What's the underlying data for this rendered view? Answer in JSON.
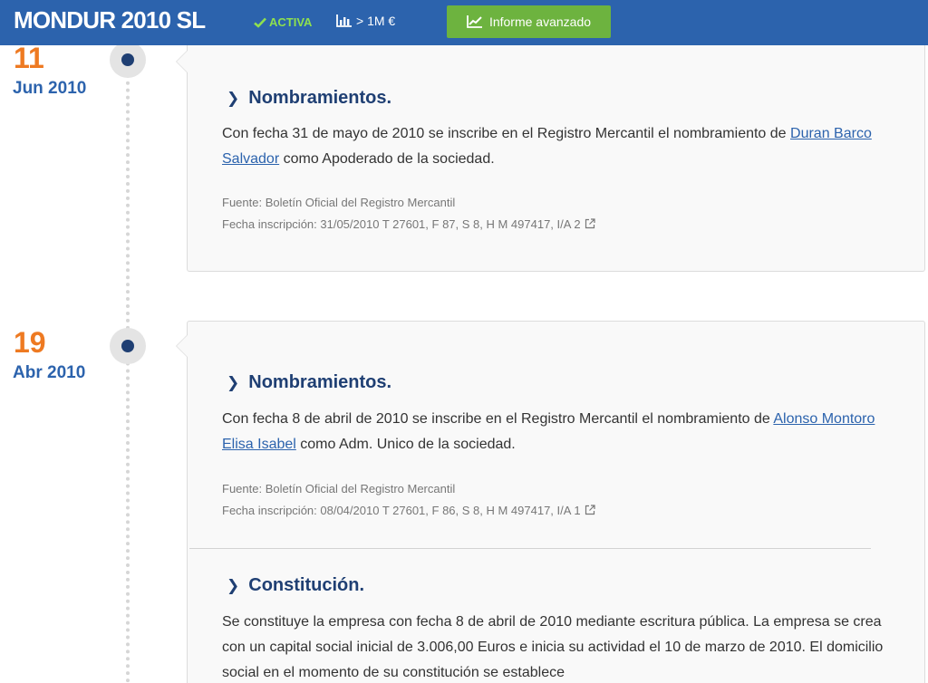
{
  "header": {
    "company": "MONDUR 2010 SL",
    "status": "ACTIVA",
    "revenue": "> 1M €",
    "report_button": "Informe avanzado"
  },
  "timeline": [
    {
      "day": "11",
      "month": "Jun 2010",
      "entries": [
        {
          "title": "Nombramientos.",
          "text_before": "Con fecha 31 de mayo de 2010 se inscribe en el Registro Mercantil el nombramiento de ",
          "link": "Duran Barco Salvador",
          "text_after": " como Apoderado de la sociedad.",
          "source": "Fuente: Boletín Oficial del Registro Mercantil",
          "inscription": "Fecha inscripción: 31/05/2010 T 27601, F 87, S 8, H M 497417, I/A 2"
        }
      ]
    },
    {
      "day": "19",
      "month": "Abr 2010",
      "entries": [
        {
          "title": "Nombramientos.",
          "text_before": "Con fecha 8 de abril de 2010 se inscribe en el Registro Mercantil el nombramiento de ",
          "link": "Alonso Montoro Elisa Isabel",
          "text_after": " como Adm. Unico de la sociedad.",
          "source": "Fuente: Boletín Oficial del Registro Mercantil",
          "inscription": "Fecha inscripción: 08/04/2010 T 27601, F 86, S 8, H M 497417, I/A 1"
        },
        {
          "title": "Constitución.",
          "text": "Se constituye la empresa con fecha 8 de abril de 2010 mediante escritura pública. La empresa se crea con un capital social inicial de 3.006,00 Euros e inicia su actividad el 10 de marzo de 2010. El domicilio social en el momento de su constitución se establece"
        }
      ]
    }
  ],
  "icons": {
    "status": "check-icon",
    "revenue": "bar-chart-icon",
    "report": "trend-line-icon",
    "inscription": "external-link-icon",
    "title": "chevron-right-icon"
  },
  "colors": {
    "header_bg": "#2c63ad",
    "status_green": "#8ee04f",
    "button_green": "#6db33f",
    "date_orange": "#ee7a22",
    "title_navy": "#1f3f73"
  }
}
